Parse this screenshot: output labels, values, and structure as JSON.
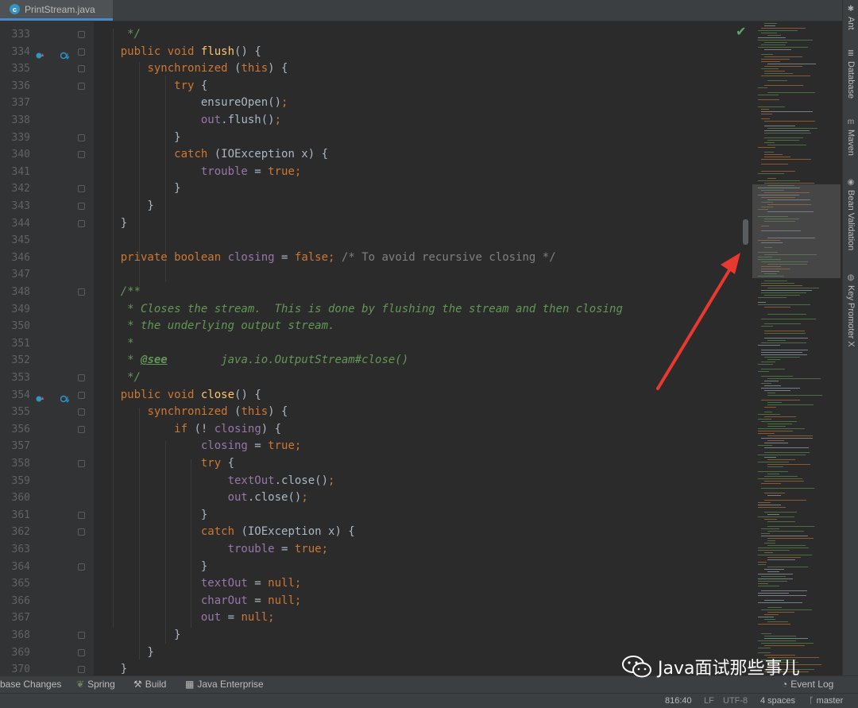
{
  "tab": {
    "label": "PrintStream.java",
    "icon": "java-class-icon"
  },
  "editor": {
    "lines": [
      {
        "n": "333",
        "segs": [
          {
            "t": "     */",
            "c": "doc"
          }
        ]
      },
      {
        "n": "334",
        "segs": [
          {
            "t": "    "
          },
          {
            "t": "public void ",
            "c": "kw"
          },
          {
            "t": "flush",
            "c": "fn"
          },
          {
            "t": "() {"
          }
        ]
      },
      {
        "n": "335",
        "segs": [
          {
            "t": "        "
          },
          {
            "t": "synchronized ",
            "c": "kw"
          },
          {
            "t": "("
          },
          {
            "t": "this",
            "c": "kw"
          },
          {
            "t": ") {"
          }
        ]
      },
      {
        "n": "336",
        "segs": [
          {
            "t": "            "
          },
          {
            "t": "try ",
            "c": "kw"
          },
          {
            "t": "{"
          }
        ]
      },
      {
        "n": "337",
        "segs": [
          {
            "t": "                ensureOpen()"
          },
          {
            "t": ";",
            "c": "kw"
          }
        ]
      },
      {
        "n": "338",
        "segs": [
          {
            "t": "                "
          },
          {
            "t": "out",
            "c": "fld"
          },
          {
            "t": ".flush()"
          },
          {
            "t": ";",
            "c": "kw"
          }
        ]
      },
      {
        "n": "339",
        "segs": [
          {
            "t": "            }"
          }
        ]
      },
      {
        "n": "340",
        "segs": [
          {
            "t": "            "
          },
          {
            "t": "catch ",
            "c": "kw"
          },
          {
            "t": "(IOException x) {"
          }
        ]
      },
      {
        "n": "341",
        "segs": [
          {
            "t": "                "
          },
          {
            "t": "trouble",
            "c": "fld"
          },
          {
            "t": " = "
          },
          {
            "t": "true;",
            "c": "kw"
          }
        ]
      },
      {
        "n": "342",
        "segs": [
          {
            "t": "            }"
          }
        ]
      },
      {
        "n": "343",
        "segs": [
          {
            "t": "        }"
          }
        ]
      },
      {
        "n": "344",
        "segs": [
          {
            "t": "    }"
          }
        ]
      },
      {
        "n": "345",
        "segs": []
      },
      {
        "n": "346",
        "segs": [
          {
            "t": "    "
          },
          {
            "t": "private boolean ",
            "c": "kw"
          },
          {
            "t": "closing",
            "c": "fld"
          },
          {
            "t": " = "
          },
          {
            "t": "false; ",
            "c": "kw"
          },
          {
            "t": "/* To avoid recursive closing */",
            "c": "cm"
          }
        ]
      },
      {
        "n": "347",
        "segs": []
      },
      {
        "n": "348",
        "segs": [
          {
            "t": "    /**",
            "c": "doc"
          }
        ]
      },
      {
        "n": "349",
        "segs": [
          {
            "t": "     * Closes the stream.  This is done by flushing the stream and then closing",
            "c": "doc"
          }
        ]
      },
      {
        "n": "350",
        "segs": [
          {
            "t": "     * the underlying output stream.",
            "c": "doc"
          }
        ]
      },
      {
        "n": "351",
        "segs": [
          {
            "t": "     *",
            "c": "doc"
          }
        ]
      },
      {
        "n": "352",
        "segs": [
          {
            "t": "     * ",
            "c": "doc"
          },
          {
            "t": "@see",
            "c": "tag"
          },
          {
            "t": "        java.io.OutputStream#close()",
            "c": "doc"
          }
        ]
      },
      {
        "n": "353",
        "segs": [
          {
            "t": "     */",
            "c": "doc"
          }
        ]
      },
      {
        "n": "354",
        "segs": [
          {
            "t": "    "
          },
          {
            "t": "public void ",
            "c": "kw"
          },
          {
            "t": "close",
            "c": "fn"
          },
          {
            "t": "() {"
          }
        ]
      },
      {
        "n": "355",
        "segs": [
          {
            "t": "        "
          },
          {
            "t": "synchronized ",
            "c": "kw"
          },
          {
            "t": "("
          },
          {
            "t": "this",
            "c": "kw"
          },
          {
            "t": ") {"
          }
        ]
      },
      {
        "n": "356",
        "segs": [
          {
            "t": "            "
          },
          {
            "t": "if ",
            "c": "kw"
          },
          {
            "t": "(! "
          },
          {
            "t": "closing",
            "c": "fld"
          },
          {
            "t": ") {"
          }
        ]
      },
      {
        "n": "357",
        "segs": [
          {
            "t": "                "
          },
          {
            "t": "closing",
            "c": "fld"
          },
          {
            "t": " = "
          },
          {
            "t": "true;",
            "c": "kw"
          }
        ]
      },
      {
        "n": "358",
        "segs": [
          {
            "t": "                "
          },
          {
            "t": "try ",
            "c": "kw"
          },
          {
            "t": "{"
          }
        ]
      },
      {
        "n": "359",
        "segs": [
          {
            "t": "                    "
          },
          {
            "t": "textOut",
            "c": "fld"
          },
          {
            "t": ".close()"
          },
          {
            "t": ";",
            "c": "kw"
          }
        ]
      },
      {
        "n": "360",
        "segs": [
          {
            "t": "                    "
          },
          {
            "t": "out",
            "c": "fld"
          },
          {
            "t": ".close()"
          },
          {
            "t": ";",
            "c": "kw"
          }
        ]
      },
      {
        "n": "361",
        "segs": [
          {
            "t": "                }"
          }
        ]
      },
      {
        "n": "362",
        "segs": [
          {
            "t": "                "
          },
          {
            "t": "catch ",
            "c": "kw"
          },
          {
            "t": "(IOException x) {"
          }
        ]
      },
      {
        "n": "363",
        "segs": [
          {
            "t": "                    "
          },
          {
            "t": "trouble",
            "c": "fld"
          },
          {
            "t": " = "
          },
          {
            "t": "true;",
            "c": "kw"
          }
        ]
      },
      {
        "n": "364",
        "segs": [
          {
            "t": "                }"
          }
        ]
      },
      {
        "n": "365",
        "segs": [
          {
            "t": "                "
          },
          {
            "t": "textOut",
            "c": "fld"
          },
          {
            "t": " = "
          },
          {
            "t": "null;",
            "c": "kw"
          }
        ]
      },
      {
        "n": "366",
        "segs": [
          {
            "t": "                "
          },
          {
            "t": "charOut",
            "c": "fld"
          },
          {
            "t": " = "
          },
          {
            "t": "null;",
            "c": "kw"
          }
        ]
      },
      {
        "n": "367",
        "segs": [
          {
            "t": "                "
          },
          {
            "t": "out",
            "c": "fld"
          },
          {
            "t": " = "
          },
          {
            "t": "null;",
            "c": "kw"
          }
        ]
      },
      {
        "n": "368",
        "segs": [
          {
            "t": "            }"
          }
        ]
      },
      {
        "n": "369",
        "segs": [
          {
            "t": "        }"
          }
        ]
      },
      {
        "n": "370",
        "segs": [
          {
            "t": "    }"
          }
        ]
      }
    ]
  },
  "right_tool_windows": [
    {
      "label": "Ant",
      "icon": "ant-icon"
    },
    {
      "label": "Database",
      "icon": "database-icon"
    },
    {
      "label": "Maven",
      "icon": "maven-icon"
    },
    {
      "label": "Bean Validation",
      "icon": "bean-validation-icon"
    },
    {
      "label": "Key Promoter X",
      "icon": "key-promoter-icon"
    }
  ],
  "bottom_tool_windows": [
    {
      "label": "base Changes",
      "icon": ""
    },
    {
      "label": "Spring",
      "icon": "spring-icon"
    },
    {
      "label": "Build",
      "icon": "hammer-icon"
    },
    {
      "label": "Java Enterprise",
      "icon": "java-enterprise-icon"
    }
  ],
  "event_log": "Event Log",
  "status": {
    "position": "816:40",
    "line_separator": "LF",
    "encoding": "UTF-8",
    "indent": "4 spaces",
    "branch": "master"
  },
  "watermark": "Java面试那些事儿",
  "colors": {
    "keyword": "#cc7832",
    "function": "#ffc66d",
    "field": "#9876aa",
    "doc": "#629755",
    "comment": "#808080",
    "arrow": "#e8382f"
  }
}
